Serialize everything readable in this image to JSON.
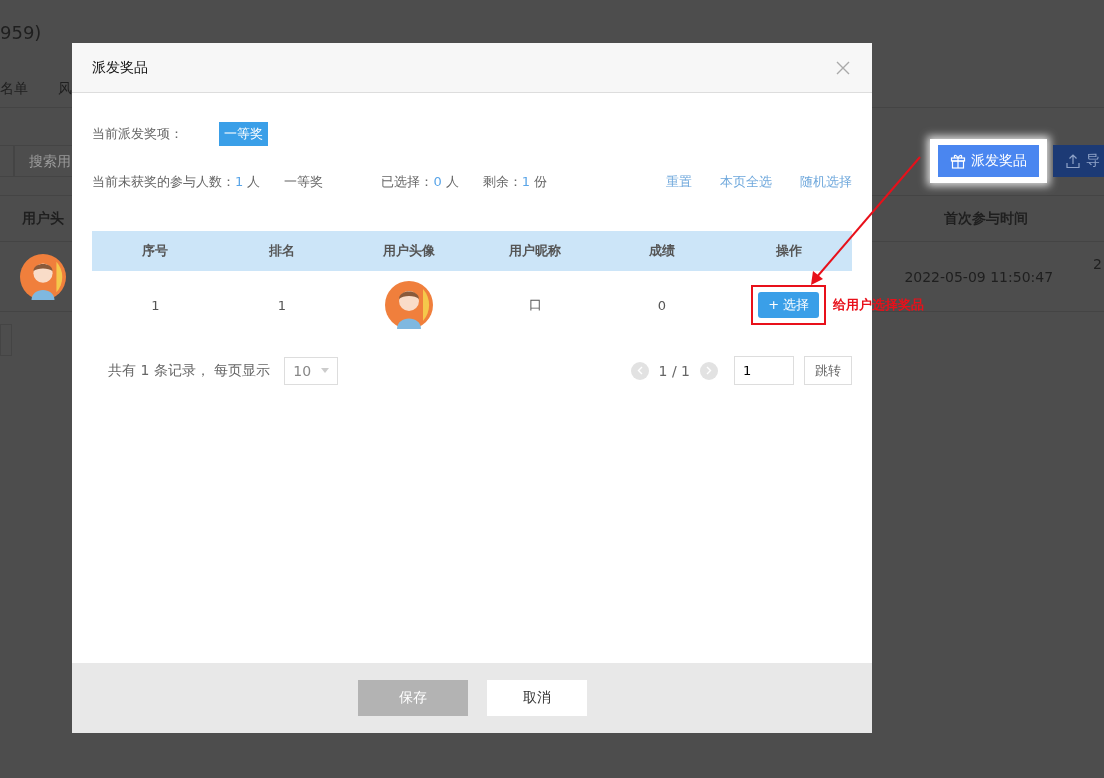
{
  "background": {
    "title": "959)",
    "tabs": [
      "名单",
      "风"
    ],
    "search": {
      "placeholder": "搜索用"
    },
    "actions": [
      {
        "label": "派发奖品",
        "highlighted": true
      },
      {
        "label": "导",
        "highlighted": false
      }
    ],
    "table": {
      "columns": [
        "用户头",
        "首次参与时间"
      ],
      "rows": [
        {
          "first_time": "2022-05-09 11:50:47",
          "column_3": "2"
        }
      ]
    }
  },
  "dialog": {
    "title": "派发奖品",
    "current_prize_label": "当前派发奖项：",
    "current_prize": "一等奖",
    "stats": [
      {
        "label": "当前未获奖的参与人数：",
        "value": "1",
        "unit": "人"
      },
      {
        "label": "一等奖"
      },
      {
        "label": "已选择：",
        "value": "0",
        "unit": "人"
      },
      {
        "label": "剩余：",
        "value": "1",
        "unit": "份"
      }
    ],
    "links": [
      "重置",
      "本页全选",
      "随机选择"
    ],
    "table": {
      "columns": [
        "序号",
        "排名",
        "用户头像",
        "用户昵称",
        "成绩",
        "操作"
      ],
      "rows": [
        {
          "index": "1",
          "rank": "1",
          "nickname": "口",
          "score": "0",
          "action": "+ 选择"
        }
      ]
    },
    "pagination": {
      "summary": "共有 1 条记录， 每页显示",
      "page_size": "10",
      "page": "1 / 1",
      "page_input": "1",
      "jump": "跳转"
    },
    "buttons": [
      {
        "label": "保存",
        "disabled": true
      },
      {
        "label": "取消",
        "disabled": false
      }
    ]
  },
  "annotation": {
    "note": "给用户选择奖品"
  }
}
